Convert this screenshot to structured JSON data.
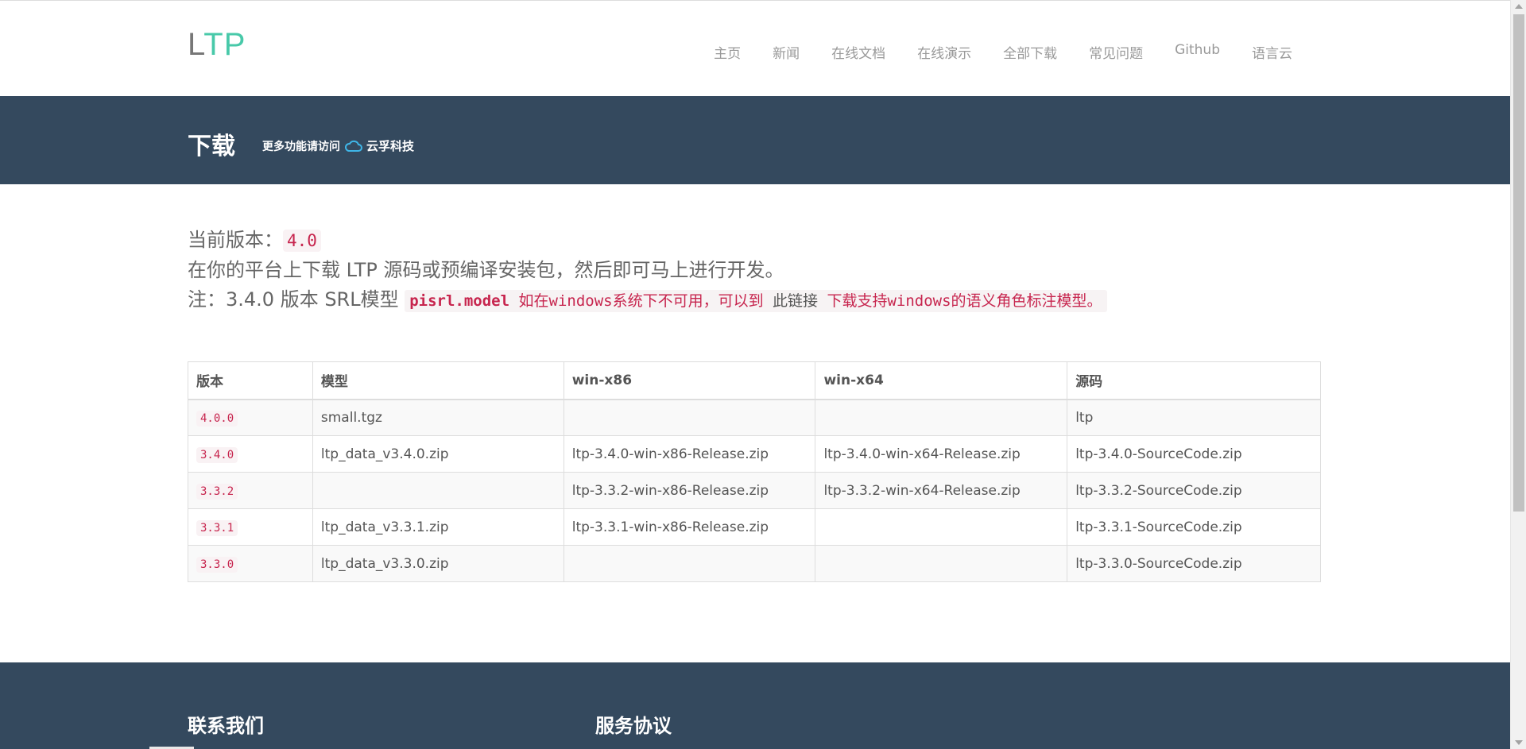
{
  "logo": {
    "l": "L",
    "tp": "TP"
  },
  "nav": [
    "主页",
    "新闻",
    "在线文档",
    "在线演示",
    "全部下载",
    "常见问题",
    "Github",
    "语言云"
  ],
  "hero": {
    "title": "下载",
    "hint": "更多功能请访问",
    "brand": "云孚科技"
  },
  "content": {
    "version_label": "当前版本：",
    "version_value": "4.0",
    "line2": "在你的平台上下载 LTP 源码或预编译安装包，然后即可马上进行开发。",
    "note_prefix": "注：3.4.0 版本 SRL模型 ",
    "note_model": "pisrl.model",
    "note_text1": " 如在windows系统下不可用，可以到 ",
    "note_link": "此链接",
    "note_text2": " 下载支持windows的语义角色标注模型。"
  },
  "table": {
    "headers": [
      "版本",
      "模型",
      "win-x86",
      "win-x64",
      "源码"
    ],
    "rows": [
      [
        "4.0.0",
        "small.tgz",
        "",
        "",
        "ltp"
      ],
      [
        "3.4.0",
        "ltp_data_v3.4.0.zip",
        "ltp-3.4.0-win-x86-Release.zip",
        "ltp-3.4.0-win-x64-Release.zip",
        "ltp-3.4.0-SourceCode.zip"
      ],
      [
        "3.3.2",
        "",
        "ltp-3.3.2-win-x86-Release.zip",
        "ltp-3.3.2-win-x64-Release.zip",
        "ltp-3.3.2-SourceCode.zip"
      ],
      [
        "3.3.1",
        "ltp_data_v3.3.1.zip",
        "ltp-3.3.1-win-x86-Release.zip",
        "",
        "ltp-3.3.1-SourceCode.zip"
      ],
      [
        "3.3.0",
        "ltp_data_v3.3.0.zip",
        "",
        "",
        "ltp-3.3.0-SourceCode.zip"
      ]
    ]
  },
  "footer": {
    "contact": "联系我们",
    "terms": "服务协议"
  },
  "colors": {
    "header_bg": "#34495e",
    "accent": "#48c9a9",
    "code": "#c7254e"
  }
}
